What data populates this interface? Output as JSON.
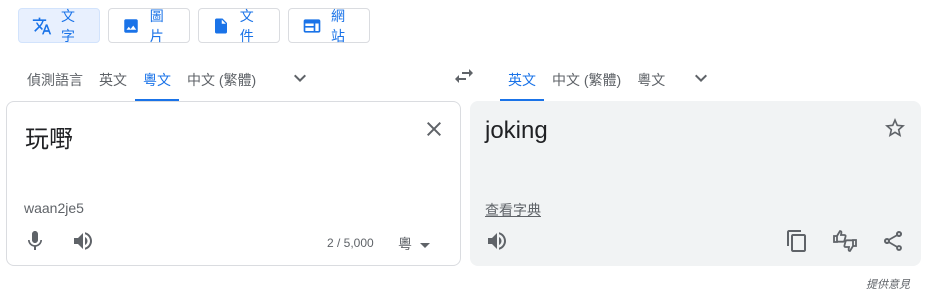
{
  "modes": [
    {
      "label": "文字",
      "icon": "translate-icon"
    },
    {
      "label": "圖片",
      "icon": "image-icon"
    },
    {
      "label": "文件",
      "icon": "document-icon"
    },
    {
      "label": "網站",
      "icon": "website-icon"
    }
  ],
  "source_langs": {
    "detect": "偵測語言",
    "tab1": "英文",
    "tab2": "粵文",
    "tab3": "中文 (繁體)"
  },
  "target_langs": {
    "tab1": "英文",
    "tab2": "中文 (繁體)",
    "tab3": "粵文"
  },
  "source": {
    "text": "玩嘢",
    "romanization": "waan2je5",
    "char_count": "2 / 5,000",
    "ime_label": "粵"
  },
  "target": {
    "text": "joking",
    "dictionary_link": "查看字典"
  },
  "footer": {
    "feedback": "提供意見"
  },
  "colors": {
    "accent": "#1a73e8",
    "icon_grey": "#5f6368",
    "target_panel_bg": "#f1f3f4"
  }
}
